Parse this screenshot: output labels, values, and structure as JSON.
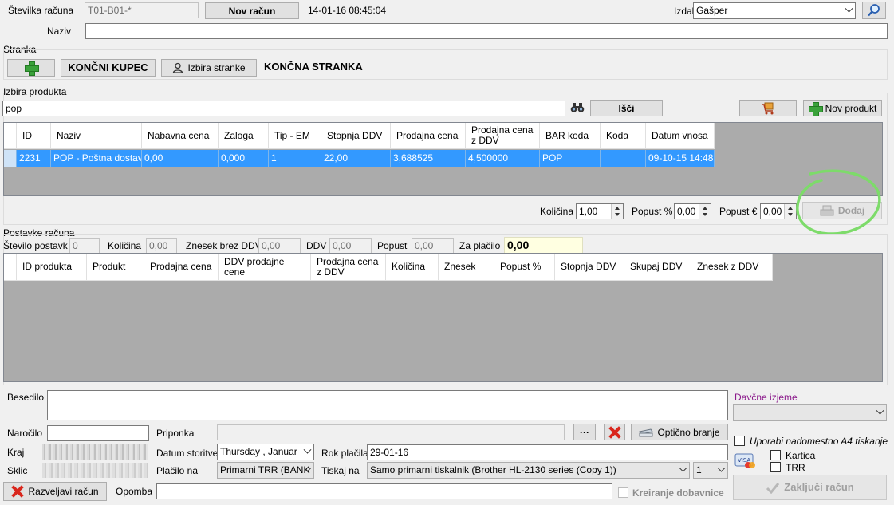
{
  "header": {
    "invoice_no_label": "Številka računa",
    "invoice_no_value": "T01-B01-*",
    "new_invoice_button": "Nov račun",
    "datetime": "14-01-16 08:45:04",
    "issued_by_label": "Izdal",
    "issued_by_value": "Gašper",
    "name_label": "Naziv",
    "name_value": ""
  },
  "customer": {
    "group_label": "Stranka",
    "end_customer_button": "KONČNI KUPEC",
    "select_customer_button": "Izbira stranke",
    "current_customer": "KONČNA STRANKA"
  },
  "product": {
    "group_label": "Izbira produkta",
    "search_value": "pop",
    "search_button": "Išči",
    "new_product_button": "Nov produkt",
    "columns": [
      "ID",
      "Naziv",
      "Nabavna cena",
      "Zaloga",
      "Tip - EM",
      "Stopnja DDV",
      "Prodajna cena",
      "Prodajna cena z DDV",
      "BAR koda",
      "Koda",
      "Datum vnosa"
    ],
    "rows": [
      [
        "2231",
        "POP - Poštna dostava",
        "0,00",
        "0,000",
        "1",
        "22,00",
        "3,688525",
        "4,500000",
        "POP",
        "",
        "09-10-15 14:48"
      ]
    ],
    "quantity_label": "Količina",
    "quantity_value": "1,00",
    "discount_pct_label": "Popust %",
    "discount_pct_value": "0,00",
    "discount_eur_label": "Popust €",
    "discount_eur_value": "0,00",
    "add_button": "Dodaj"
  },
  "items": {
    "group_label": "Postavke računa",
    "count_label": "Število postavk",
    "count_value": "0",
    "qty_label": "Količina",
    "qty_value": "0,00",
    "net_label": "Znesek brez DDV",
    "net_value": "0,00",
    "vat_label": "DDV",
    "vat_value": "0,00",
    "discount_label": "Popust",
    "discount_value": "0,00",
    "to_pay_label": "Za plačilo",
    "to_pay_value": "0,00",
    "columns": [
      "ID produkta",
      "Produkt",
      "Prodajna cena",
      "DDV prodajne cene",
      "Prodajna cena z DDV",
      "Količina",
      "Znesek",
      "Popust %",
      "Stopnja DDV",
      "Skupaj DDV",
      "Znesek z DDV"
    ]
  },
  "footer": {
    "text_label": "Besedilo",
    "tax_exempt_label": "Davčne izjeme",
    "order_label": "Naročilo",
    "attachment_label": "Priponka",
    "ellipsis_button": "···",
    "optical_scan_button": "Optično branje",
    "a4_print_label": "Uporabi nadomestno A4 tiskanje",
    "place_label": "Kraj",
    "service_date_label": "Datum storitve",
    "service_date_day": "Thursday",
    "service_date_month": "Januar",
    "due_date_label": "Rok plačila",
    "due_date_value": "29-01-16",
    "card_label": "Kartica",
    "trr_label": "TRR",
    "ref_label": "Sklic",
    "payment_label": "Plačilo na",
    "payment_value": "Primarni TRR (BANK",
    "print_label": "Tiskaj na",
    "printer_value": "Samo primarni tiskalnik (Brother HL-2130 series (Copy 1))",
    "copies_value": "1",
    "cancel_button": "Razveljavi račun",
    "note_label": "Opomba",
    "delivery_note_label": "Kreiranje dobavnice",
    "finish_button": "Zaključi račun"
  },
  "colors": {
    "selection": "#3399ff",
    "grid_bg": "#ababab",
    "highlight_green": "#7ddb6a",
    "tax_exempt_label": "#8b1a8b"
  }
}
